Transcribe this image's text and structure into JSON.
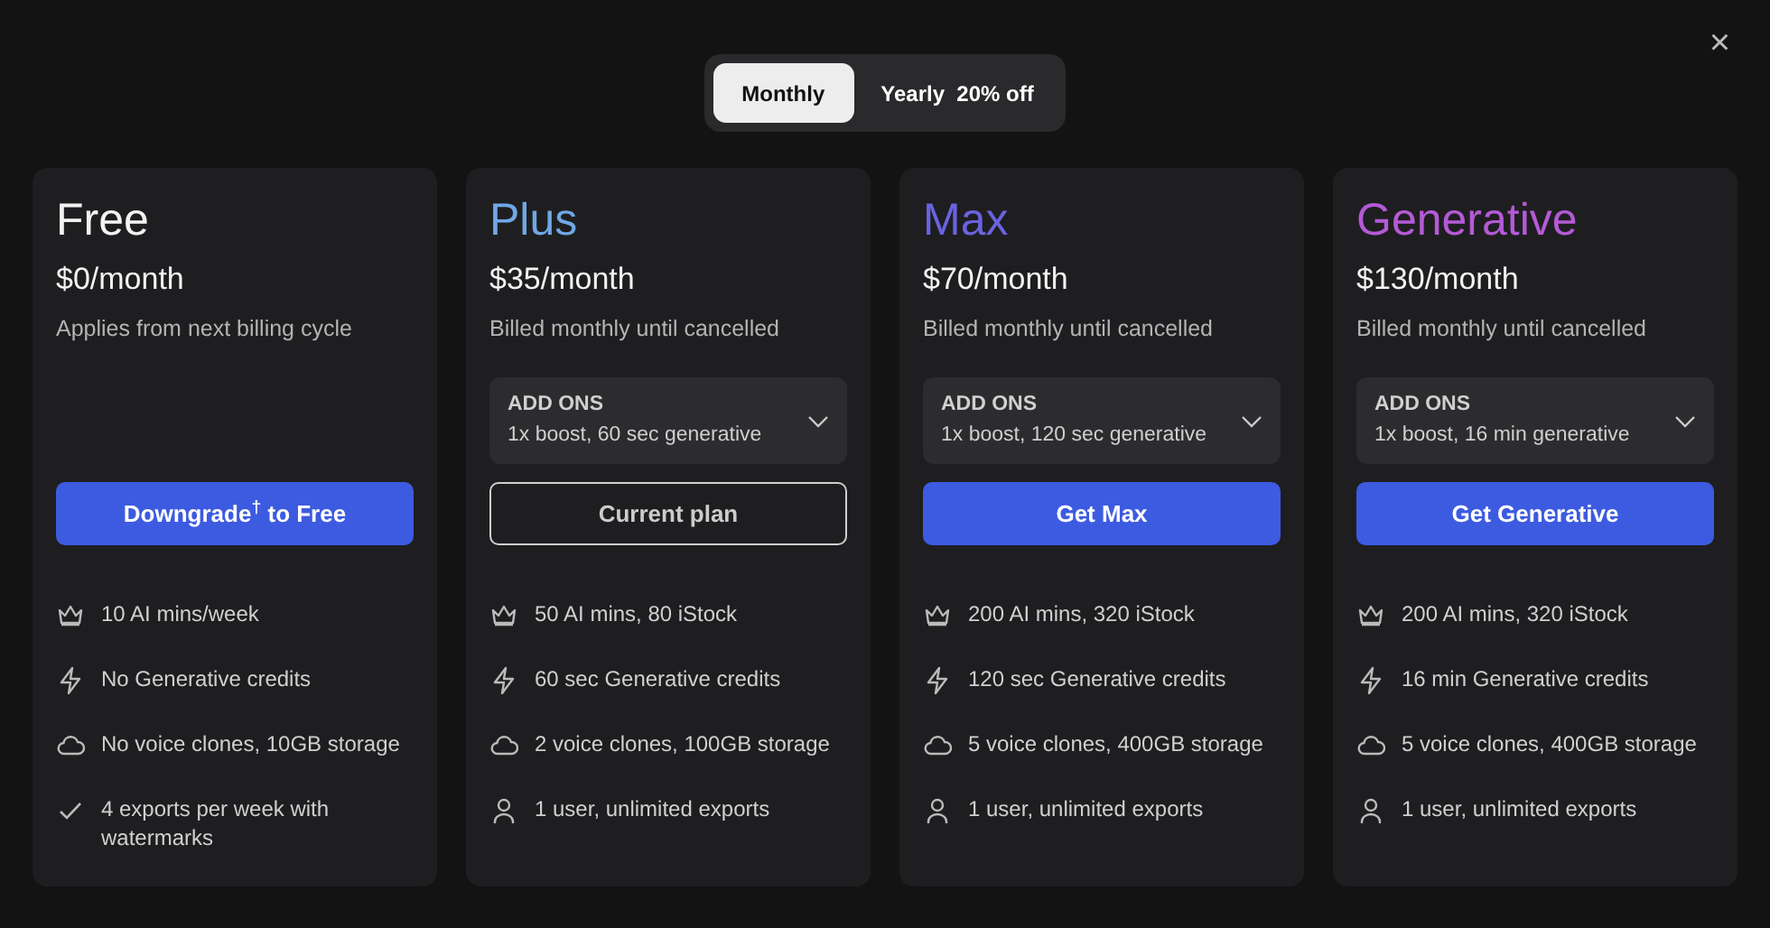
{
  "billing_toggle": [
    {
      "label": "Monthly",
      "selected": true
    },
    {
      "label": "Yearly  20% off",
      "selected": false
    }
  ],
  "close": "×",
  "plans": [
    {
      "name": "Free",
      "color": "#f2f2f2",
      "price": "$0/month",
      "note": "Applies from next billing cycle",
      "button": {
        "label": "Downgrade$^{†}$ to Free",
        "kind": "primary"
      },
      "features": [
        {
          "kind": "crown",
          "text": "10 AI mins/week"
        },
        {
          "kind": "bolt",
          "text": "No Generative credits"
        },
        {
          "kind": "cloud",
          "text": "No voice clones, 10GB storage"
        },
        {
          "kind": "check",
          "text": "4 exports per week with watermarks"
        }
      ]
    },
    {
      "name": "Plus",
      "color": "#6fa8e6",
      "price": "$35/month",
      "note": "Billed monthly until cancelled",
      "addons": {
        "label": "ADD ONS",
        "value": "1x boost, 60 sec generative"
      },
      "button": {
        "label": "Current plan",
        "kind": "outline"
      },
      "features": [
        {
          "kind": "crown",
          "text": "50 AI mins, 80 iStock"
        },
        {
          "kind": "bolt",
          "text": "60 sec Generative credits"
        },
        {
          "kind": "cloud",
          "text": "2 voice clones, 100GB storage"
        },
        {
          "kind": "user",
          "text": "1 user, unlimited exports"
        }
      ]
    },
    {
      "name": "Max",
      "color": "#6a63e0",
      "price": "$70/month",
      "note": "Billed monthly until cancelled",
      "addons": {
        "label": "ADD ONS",
        "value": "1x boost, 120 sec generative"
      },
      "button": {
        "label": "Get Max",
        "kind": "primary"
      },
      "features": [
        {
          "kind": "crown",
          "text": "200 AI mins, 320 iStock"
        },
        {
          "kind": "bolt",
          "text": "120 sec Generative credits"
        },
        {
          "kind": "cloud",
          "text": "5 voice clones, 400GB storage"
        },
        {
          "kind": "user",
          "text": "1 user, unlimited exports"
        }
      ]
    },
    {
      "name": "Generative",
      "color": "#b45ad6",
      "price": "$130/month",
      "note": "Billed monthly until cancelled",
      "addons": {
        "label": "ADD ONS",
        "value": "1x boost, 16 min generative"
      },
      "button": {
        "label": "Get Generative",
        "kind": "primary"
      },
      "features": [
        {
          "kind": "crown",
          "text": "200 AI mins, 320 iStock"
        },
        {
          "kind": "bolt",
          "text": "16 min Generative credits"
        },
        {
          "kind": "cloud",
          "text": "5 voice clones, 400GB storage"
        },
        {
          "kind": "user",
          "text": "1 user, unlimited exports"
        }
      ]
    }
  ]
}
